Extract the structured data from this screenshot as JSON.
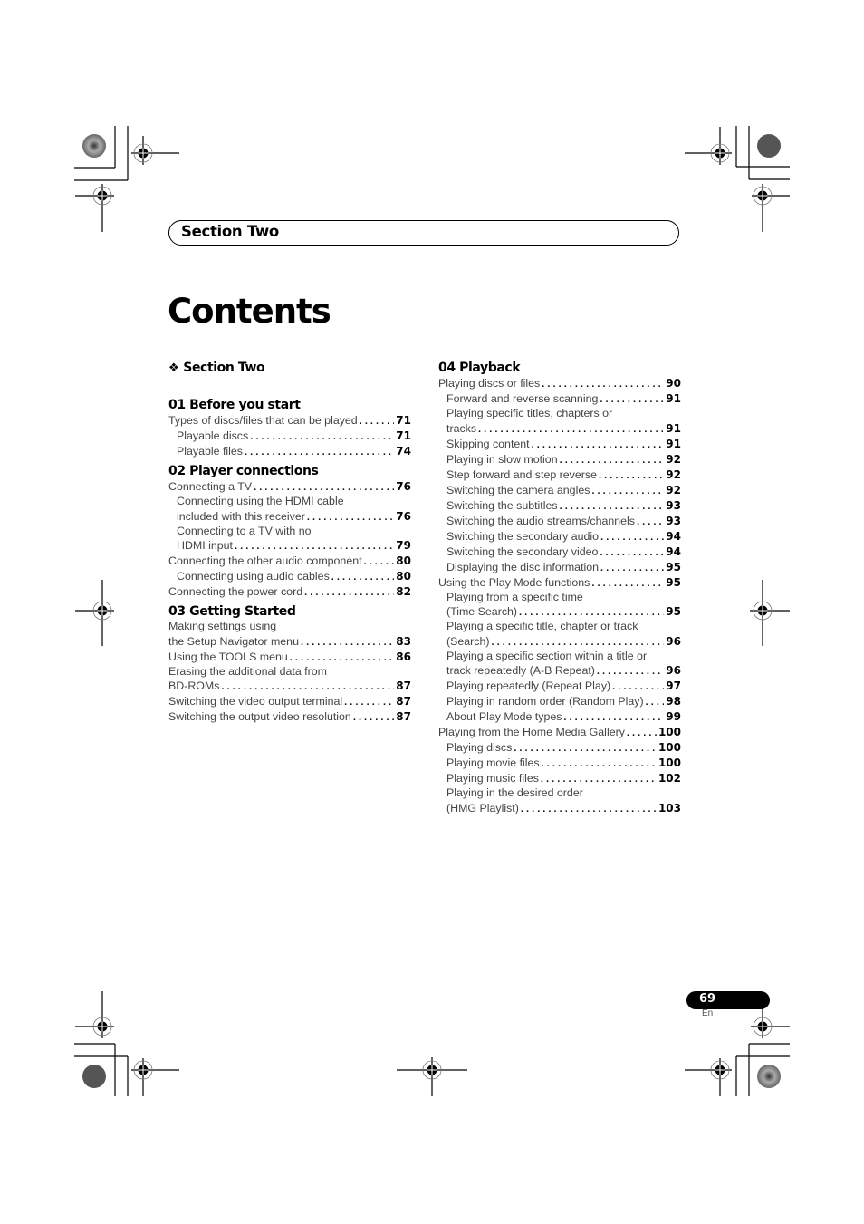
{
  "section_banner": "Section Two",
  "page_title": "Contents",
  "part_heading": {
    "icon": "diamond-icon",
    "label": "Section Two"
  },
  "left_column": [
    {
      "title": "01 Before you start",
      "entries": [
        {
          "level": 0,
          "lines": [
            "Types of discs/files that can be played"
          ],
          "page": "71"
        },
        {
          "level": 1,
          "lines": [
            "Playable discs"
          ],
          "page": "71"
        },
        {
          "level": 1,
          "lines": [
            "Playable files"
          ],
          "page": "74"
        }
      ]
    },
    {
      "title": "02 Player connections",
      "entries": [
        {
          "level": 0,
          "lines": [
            "Connecting a TV"
          ],
          "page": "76"
        },
        {
          "level": 1,
          "lines": [
            "Connecting using the HDMI cable",
            "included with this receiver"
          ],
          "page": "76"
        },
        {
          "level": 1,
          "lines": [
            "Connecting to a TV with no",
            "HDMI input"
          ],
          "page": "79"
        },
        {
          "level": 0,
          "lines": [
            "Connecting the other audio component"
          ],
          "page": "80"
        },
        {
          "level": 1,
          "lines": [
            "Connecting using audio cables"
          ],
          "page": "80"
        },
        {
          "level": 0,
          "lines": [
            "Connecting the power cord"
          ],
          "page": "82"
        }
      ]
    },
    {
      "title": "03 Getting Started",
      "entries": [
        {
          "level": 0,
          "lines": [
            "Making settings using",
            "the Setup Navigator menu"
          ],
          "page": "83"
        },
        {
          "level": 0,
          "lines": [
            "Using the TOOLS menu"
          ],
          "page": "86"
        },
        {
          "level": 0,
          "lines": [
            "Erasing the additional data from",
            "BD-ROMs"
          ],
          "page": "87"
        },
        {
          "level": 0,
          "lines": [
            "Switching the video output terminal"
          ],
          "page": "87"
        },
        {
          "level": 0,
          "lines": [
            "Switching the output video resolution"
          ],
          "page": "87"
        }
      ]
    }
  ],
  "right_column": [
    {
      "title": "04 Playback",
      "entries": [
        {
          "level": 0,
          "lines": [
            "Playing discs or files"
          ],
          "page": "90"
        },
        {
          "level": 1,
          "lines": [
            "Forward and reverse scanning"
          ],
          "page": "91"
        },
        {
          "level": 1,
          "lines": [
            "Playing specific titles, chapters or",
            "tracks"
          ],
          "page": "91"
        },
        {
          "level": 1,
          "lines": [
            "Skipping content"
          ],
          "page": "91"
        },
        {
          "level": 1,
          "lines": [
            "Playing in slow motion"
          ],
          "page": "92"
        },
        {
          "level": 1,
          "lines": [
            "Step forward and step reverse"
          ],
          "page": "92"
        },
        {
          "level": 1,
          "lines": [
            "Switching the camera angles"
          ],
          "page": "92"
        },
        {
          "level": 1,
          "lines": [
            "Switching the subtitles"
          ],
          "page": "93"
        },
        {
          "level": 1,
          "lines": [
            "Switching the audio streams/channels"
          ],
          "page": "93"
        },
        {
          "level": 1,
          "lines": [
            "Switching the secondary audio"
          ],
          "page": "94"
        },
        {
          "level": 1,
          "lines": [
            "Switching the secondary video"
          ],
          "page": "94"
        },
        {
          "level": 1,
          "lines": [
            "Displaying the disc information"
          ],
          "page": "95"
        },
        {
          "level": 0,
          "lines": [
            "Using the Play Mode functions"
          ],
          "page": "95"
        },
        {
          "level": 1,
          "lines": [
            "Playing from a specific time",
            "(Time Search)"
          ],
          "page": "95"
        },
        {
          "level": 1,
          "lines": [
            "Playing a specific title, chapter or track",
            "(Search)"
          ],
          "page": "96"
        },
        {
          "level": 1,
          "lines": [
            "Playing a specific section within a title or",
            "track repeatedly (A-B Repeat)"
          ],
          "page": "96"
        },
        {
          "level": 1,
          "lines": [
            "Playing repeatedly (Repeat Play)"
          ],
          "page": "97"
        },
        {
          "level": 1,
          "lines": [
            "Playing in random order (Random Play)"
          ],
          "page": "98"
        },
        {
          "level": 1,
          "lines": [
            "About Play Mode types"
          ],
          "page": "99"
        },
        {
          "level": 0,
          "lines": [
            "Playing from the Home Media Gallery"
          ],
          "page": "100"
        },
        {
          "level": 1,
          "lines": [
            "Playing discs"
          ],
          "page": "100"
        },
        {
          "level": 1,
          "lines": [
            "Playing movie files"
          ],
          "page": "100"
        },
        {
          "level": 1,
          "lines": [
            "Playing music files"
          ],
          "page": "102"
        },
        {
          "level": 1,
          "lines": [
            "Playing in the desired order",
            "(HMG Playlist)"
          ],
          "page": "103"
        }
      ]
    }
  ],
  "footer": {
    "page_number": "69",
    "language": "En"
  },
  "colors": {
    "text": "#000000",
    "entry_text": "#444444",
    "page_tab_bg": "#000000",
    "page_tab_text": "#ffffff"
  }
}
